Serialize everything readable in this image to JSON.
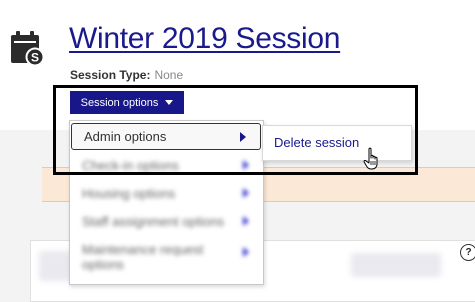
{
  "header": {
    "title": "Winter 2019 Session",
    "session_type_label": "Session Type:",
    "session_type_value": "None"
  },
  "session_button": {
    "label": "Session options"
  },
  "dropdown": {
    "items": [
      {
        "label": "Admin options",
        "has_submenu": true
      },
      {
        "label": "Check-in options",
        "has_submenu": true
      },
      {
        "label": "Housing options",
        "has_submenu": false
      },
      {
        "label": "Staff assignment options",
        "has_submenu": false
      },
      {
        "label": "Maintenance request options",
        "has_submenu": false
      }
    ]
  },
  "submenu": {
    "items": [
      {
        "label": "Delete session"
      }
    ]
  },
  "help": {
    "label": "?"
  },
  "colors": {
    "brand_navy": "#17178a",
    "link": "#1a1a8c",
    "banner": "#fbe8d6"
  }
}
